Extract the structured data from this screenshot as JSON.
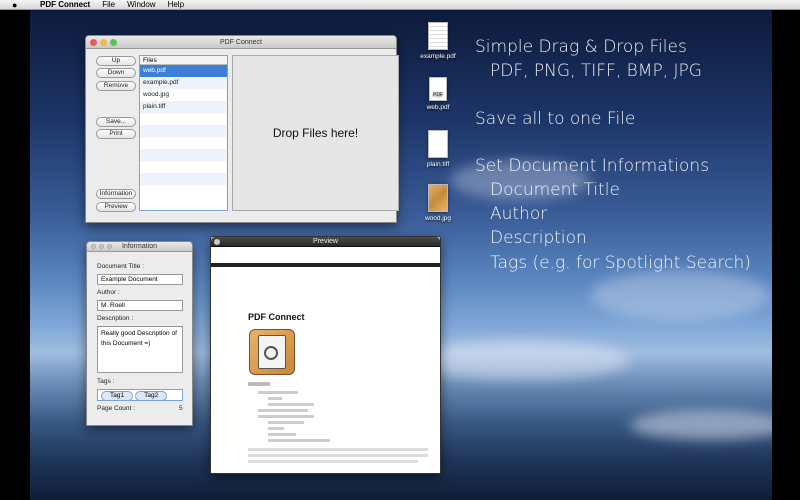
{
  "menubar": {
    "app": "PDF Connect",
    "items": [
      "File",
      "Window",
      "Help"
    ]
  },
  "main_window": {
    "title": "PDF Connect",
    "buttons": {
      "up": "Up",
      "down": "Down",
      "remove": "Remove",
      "save": "Save...",
      "print": "Print",
      "information": "Information",
      "preview": "Preview"
    },
    "files_header": "Files",
    "files": [
      "web.pdf",
      "example.pdf",
      "wood.jpg",
      "plain.tiff"
    ],
    "selected_file": "web.pdf",
    "dropzone": "Drop Files here!"
  },
  "desktop_icons": [
    {
      "label": "example.pdf",
      "icon": "pdf-document-icon"
    },
    {
      "label": "web.pdf",
      "icon": "pdf-document-icon",
      "badge": "PDF"
    },
    {
      "label": "plain.tiff",
      "icon": "tiff-image-icon"
    },
    {
      "label": "wood.jpg",
      "icon": "jpg-image-icon"
    }
  ],
  "features": {
    "line1": "Simple Drag & Drop Files",
    "line2": "PDF, PNG, TIFF, BMP, JPG",
    "line3": "Save all to one File",
    "line4": "Set Document Informations",
    "line5": "Document Title",
    "line6": "Author",
    "line7": "Description",
    "line8": "Tags (e.g. for Spotlight Search)"
  },
  "info_window": {
    "title": "Information",
    "title_label": "Document Title :",
    "title_value": "Example Document",
    "author_label": "Author :",
    "author_value": "M. Roell",
    "desc_label": "Description :",
    "desc_value": "Really good Description of this Document =)",
    "tags_label": "Tags :",
    "tags": [
      "Tag1",
      "Tag2"
    ],
    "page_count_label": "Page Count :",
    "page_count": "5"
  },
  "preview_window": {
    "title": "Preview",
    "doc_heading": "PDF Connect"
  },
  "colors": {
    "selection": "#3d7fd8",
    "accent_border": "#7aa4d8"
  }
}
